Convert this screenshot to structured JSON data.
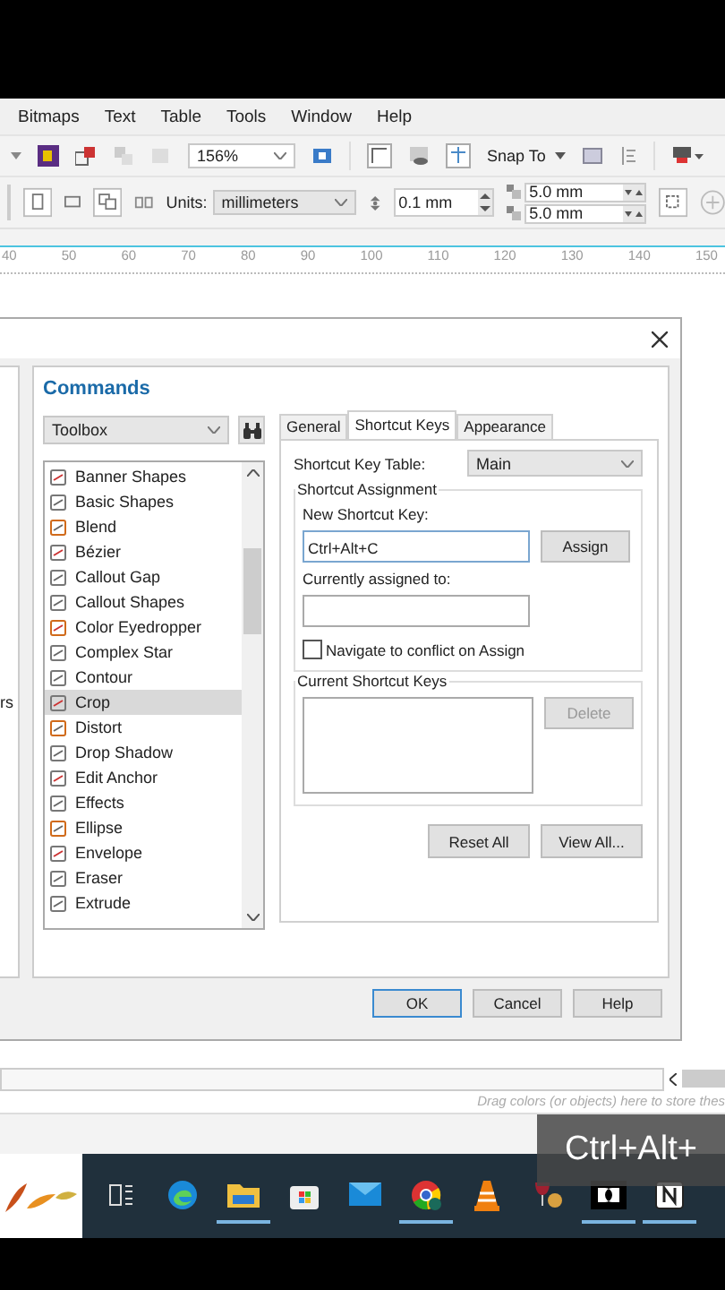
{
  "menu": [
    {
      "label": "Bitmaps"
    },
    {
      "label": "Text"
    },
    {
      "label": "Table"
    },
    {
      "label": "Tools"
    },
    {
      "label": "Window"
    },
    {
      "label": "Help"
    }
  ],
  "toolbar": {
    "zoom": "156%",
    "snap": "Snap To"
  },
  "property_bar": {
    "units_label": "Units:",
    "units": "millimeters",
    "nudge": "0.1 mm",
    "dup_x": "5.0 mm",
    "dup_y": "5.0 mm"
  },
  "ruler": [
    "40",
    "50",
    "60",
    "70",
    "80",
    "90",
    "100",
    "110",
    "120",
    "130",
    "140",
    "150"
  ],
  "dialog": {
    "left_fragment": "rs",
    "title": "Commands",
    "category": "Toolbox",
    "commands": [
      {
        "label": "Banner Shapes",
        "selected": false
      },
      {
        "label": "Basic Shapes",
        "selected": false
      },
      {
        "label": "Blend",
        "selected": false
      },
      {
        "label": "Bézier",
        "selected": false
      },
      {
        "label": "Callout Gap",
        "selected": false
      },
      {
        "label": "Callout Shapes",
        "selected": false
      },
      {
        "label": "Color Eyedropper",
        "selected": false
      },
      {
        "label": "Complex Star",
        "selected": false
      },
      {
        "label": "Contour",
        "selected": false
      },
      {
        "label": "Crop",
        "selected": true
      },
      {
        "label": "Distort",
        "selected": false
      },
      {
        "label": "Drop Shadow",
        "selected": false
      },
      {
        "label": "Edit Anchor",
        "selected": false
      },
      {
        "label": "Effects",
        "selected": false
      },
      {
        "label": "Ellipse",
        "selected": false
      },
      {
        "label": "Envelope",
        "selected": false
      },
      {
        "label": "Eraser",
        "selected": false
      },
      {
        "label": "Extrude",
        "selected": false
      }
    ],
    "tabs": [
      {
        "label": "General",
        "selected": false
      },
      {
        "label": "Shortcut Keys",
        "selected": true
      },
      {
        "label": "Appearance",
        "selected": false
      }
    ],
    "table_label": "Shortcut Key Table:",
    "table_value": "Main",
    "assignment_group": "Shortcut Assignment",
    "new_key_label": "New Shortcut Key:",
    "new_key_value": "Ctrl+Alt+C",
    "assign": "Assign",
    "assigned_label": "Currently assigned to:",
    "navigate": {
      "label": "Navigate to conflict on Assign",
      "checked": false
    },
    "current_group": "Current Shortcut Keys",
    "delete": {
      "label": "Delete",
      "disabled": true
    },
    "reset_all": "Reset All",
    "view_all": "View All...",
    "buttons": [
      {
        "label": "OK",
        "default": true
      },
      {
        "label": "Cancel",
        "default": false
      },
      {
        "label": "Help",
        "default": false
      }
    ]
  },
  "palette_hint": "Drag colors (or objects) here to store thes",
  "key_overlay": "Ctrl+Alt+",
  "taskbar": [
    {
      "kind": "taskview",
      "running": false
    },
    {
      "kind": "edge",
      "running": false
    },
    {
      "kind": "explorer",
      "running": true
    },
    {
      "kind": "store",
      "running": false
    },
    {
      "kind": "mail",
      "running": false
    },
    {
      "kind": "chrome",
      "running": true
    },
    {
      "kind": "vlc",
      "running": false
    },
    {
      "kind": "wine",
      "running": false
    },
    {
      "kind": "dolby",
      "running": true
    },
    {
      "kind": "notion",
      "running": true
    }
  ]
}
